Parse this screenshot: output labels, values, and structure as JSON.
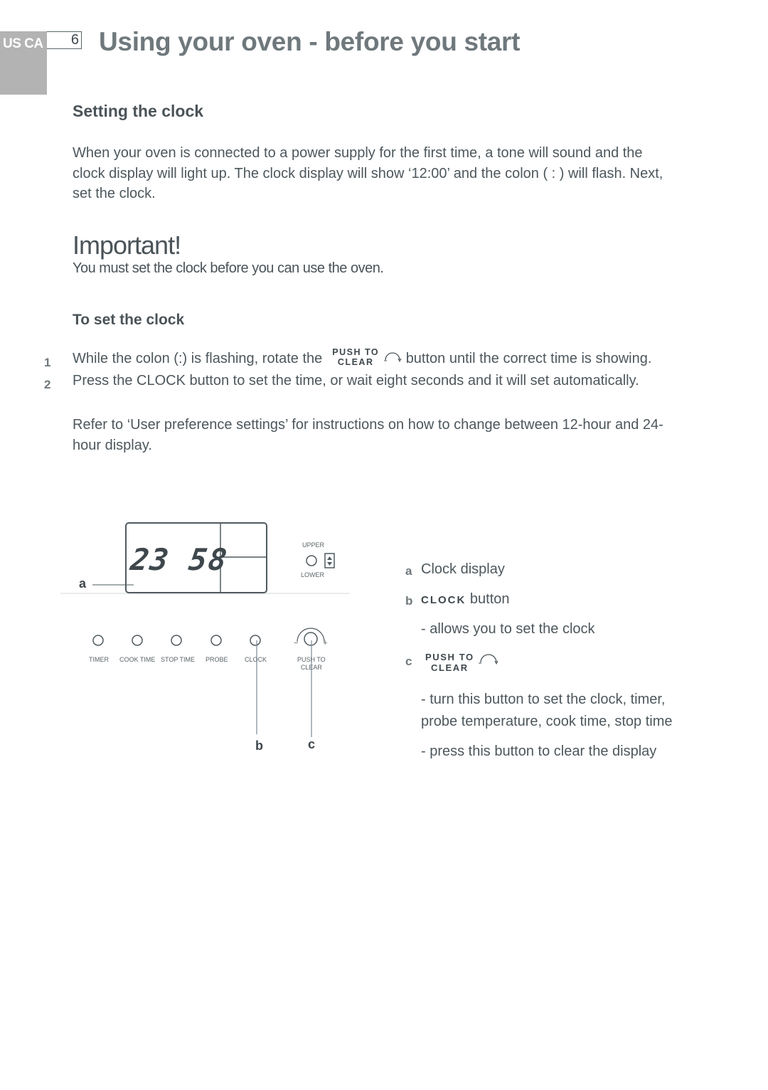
{
  "header": {
    "region_label": "US CA",
    "page_number": "6",
    "title": "Using your oven - before you start"
  },
  "section": {
    "heading": "Setting the clock",
    "intro_lines": [
      "When your oven is connected to a power supply for the first time, a tone will sound and the",
      "clock display will light up.  The clock display will show ‘12:00’ and the colon ( : ) will flash.  Next,",
      "set the clock."
    ]
  },
  "important": {
    "title": "Important!",
    "text": "You must set the clock before you can use the oven."
  },
  "procedure": {
    "heading": "To set the clock",
    "steps": [
      {
        "number": "1",
        "text_before": "While the colon (:) is flashing, rotate the",
        "button_line1": "PUSH TO",
        "button_line2": "CLEAR",
        "text_after": "button until the correct time is showing."
      },
      {
        "number": "2",
        "text": "Press the CLOCK button to set the time, or wait eight seconds and it will set automatically."
      }
    ],
    "refer_lines": [
      "Refer to ‘User preference settings’ for instructions on how to change between 12-hour and 24-",
      "hour display."
    ]
  },
  "diagram": {
    "display_value": "23 58",
    "upper_label": "UPPER",
    "lower_label": "LOWER",
    "buttons": [
      "TIMER",
      "COOK TIME",
      "STOP TIME",
      "PROBE",
      "CLOCK"
    ],
    "dial_label_line1": "PUSH TO",
    "dial_label_line2": "CLEAR",
    "dial_minus": "−",
    "dial_plus": "+",
    "callout_a": "a",
    "callout_b": "b",
    "callout_c": "c"
  },
  "legend": {
    "a_letter": "a",
    "a_text": "Clock display",
    "b_letter": "b",
    "b_caps": "CLOCK",
    "b_text": "button",
    "b_desc": "- allows you to set the clock",
    "c_letter": "c",
    "c_line1": "PUSH TO",
    "c_line2": "CLEAR",
    "c_desc_1": "- turn this button to set the clock, timer,",
    "c_desc_2": "probe temperature, cook time, stop time",
    "c_desc_3": "- press this button to clear the display"
  },
  "colors": {
    "tab_gray": "#b2b3b2",
    "title_gray": "#6f787c",
    "text_dark": "#4d575c",
    "line_color": "#5a6468"
  }
}
